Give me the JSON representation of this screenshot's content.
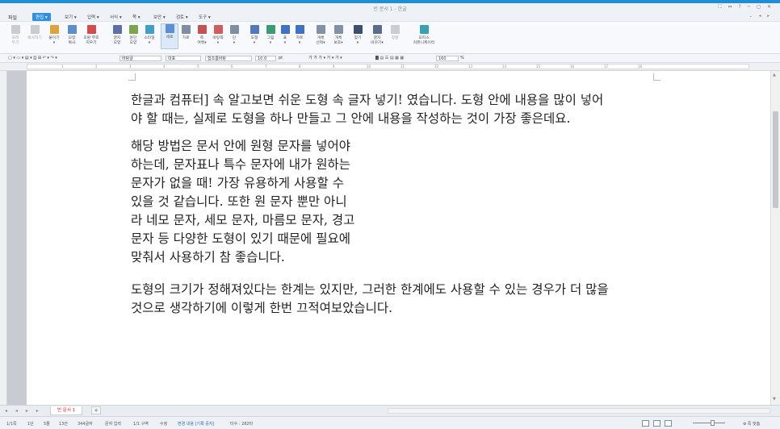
{
  "window": {
    "title": "빈 문서 1 - 한글",
    "controls": "⛶ ⇔ ?  ─ ◻ ✕"
  },
  "menu": {
    "file": "파일",
    "items": [
      {
        "label": "편집 ▾",
        "active": true
      },
      {
        "label": "보기 ▾"
      },
      {
        "label": "입력 ▾"
      },
      {
        "label": "서식 ▾"
      },
      {
        "label": "쪽 ▾"
      },
      {
        "label": "보안 ▾"
      },
      {
        "label": "검토 ▾"
      },
      {
        "label": "도구 ▾"
      }
    ],
    "right_tools": "⌄ ◂ ▸"
  },
  "ribbon": [
    {
      "label": "오려\n두기",
      "disabled": true,
      "color": "#8a8f99"
    },
    {
      "label": "복사하기",
      "disabled": true,
      "color": "#8a8f99"
    },
    {
      "label": "붙이기\n▾",
      "color": "#e0a33a"
    },
    {
      "label": "모양\n복사",
      "color": "#5c8ec9"
    },
    {
      "label": "조판 부호\n지우기",
      "color": "#d54b4b"
    },
    {
      "label": "글자\n모양",
      "color": "#5d6fa8"
    },
    {
      "label": "문단\n모양",
      "color": "#7ba54a"
    },
    {
      "label": "스타일\n▾",
      "color": "#3fa0c7"
    },
    {
      "label": "세로",
      "color": "#5b8fd6",
      "selected": true
    },
    {
      "label": "가로",
      "color": "#7f8ea3"
    },
    {
      "label": "쪽\n여백▾",
      "color": "#c55151"
    },
    {
      "label": "바탕쪽\n▾",
      "color": "#cf5d5d"
    },
    {
      "label": "단\n▾",
      "color": "#7f8ea3"
    },
    {
      "label": "도형\n▾",
      "color": "#5079c0"
    },
    {
      "label": "그림\n▾",
      "color": "#3a9c74"
    },
    {
      "label": "표\n▾",
      "color": "#3d72c4"
    },
    {
      "label": "차트\n▾",
      "color": "#3d72c4"
    },
    {
      "label": "개체\n선택▾",
      "color": "#8391a6"
    },
    {
      "label": "개체\n보호▾",
      "color": "#8391a6"
    },
    {
      "label": "찾기\n▾",
      "color": "#3b4f6e"
    },
    {
      "label": "글자\n바꾸기▾",
      "color": "#5a6d8c"
    },
    {
      "label": "정렬",
      "disabled": true,
      "color": "#8a8f99"
    },
    {
      "label": "오피스\n커뮤니케이터",
      "color": "#3aa0b4"
    }
  ],
  "toolbar": {
    "style": "바탕글",
    "lang": "대표",
    "font": "함초롬바탕",
    "size": "10.0",
    "size_unit": "pt",
    "bold_etc": "가 가 가 ▾ 가 ▾ 가 ▾",
    "line_spacing": "160",
    "line_spacing_unit": "%",
    "quick_icons": "▢ ▾ ▭ ▾ ▤ ▾  ⎙ ⊞  ↶ ▾ ↷ ▾"
  },
  "ruler_numbers": [
    "1",
    "2",
    "3",
    "4",
    "5",
    "6",
    "7",
    "8",
    "9",
    "10",
    "11",
    "12",
    "13",
    "14",
    "15",
    "16",
    "17",
    "18"
  ],
  "document": {
    "para1": [
      "한글과 컴퓨터] 속 알고보면 쉬운 도형 속 글자 넣기! 였습니다. 도형 안에 내용을 많이 넣어",
      "야 할 때는, 실제로 도형을 하나 만들고 그 안에 내용을 작성하는 것이 가장 좋은데요."
    ],
    "para2": [
      "해당 방법은 문서 안에 원형  문자를 넣어야",
      "하는데, 문자표나 특수 문자에 내가 원하는",
      "문자가 없을 때! 가장 유용하게 사용할 수",
      "있을 것 같습니다. 또한 원 문자 뿐만 아니",
      "라 네모 문자, 세모 문자, 마름모 문자, 경고",
      "문자 등 다양한 도형이 있기 때문에 필요에",
      "맞춰서 사용하기 참 좋습니다."
    ],
    "para3": [
      "도형의 크기가 정해져있다는 한계는 있지만, 그러한 한계에도 사용할 수 있는 경우가 더 많을",
      "것으로 생각하기에 이렇게 한번 끄적여보았습니다."
    ]
  },
  "tabs": {
    "nav": "◂ ◂ ▸ ▸",
    "doc_tab": "빈 문서 1",
    "add": "+"
  },
  "status": {
    "page": "1/1쪽",
    "section": "1단",
    "line": "5줄",
    "column": "13칸",
    "chars": "344글자",
    "mode": "문자 입력",
    "zone": "1/1 구역",
    "insert": "수정",
    "track_changes": "변경 내용 [기록 중지]",
    "typing_count": "타수 : 282타",
    "zoom": "⊕ 쪽 맞춤"
  },
  "colors": {
    "accent": "#2f8fe0",
    "topstrip": "#1f8ed6"
  }
}
